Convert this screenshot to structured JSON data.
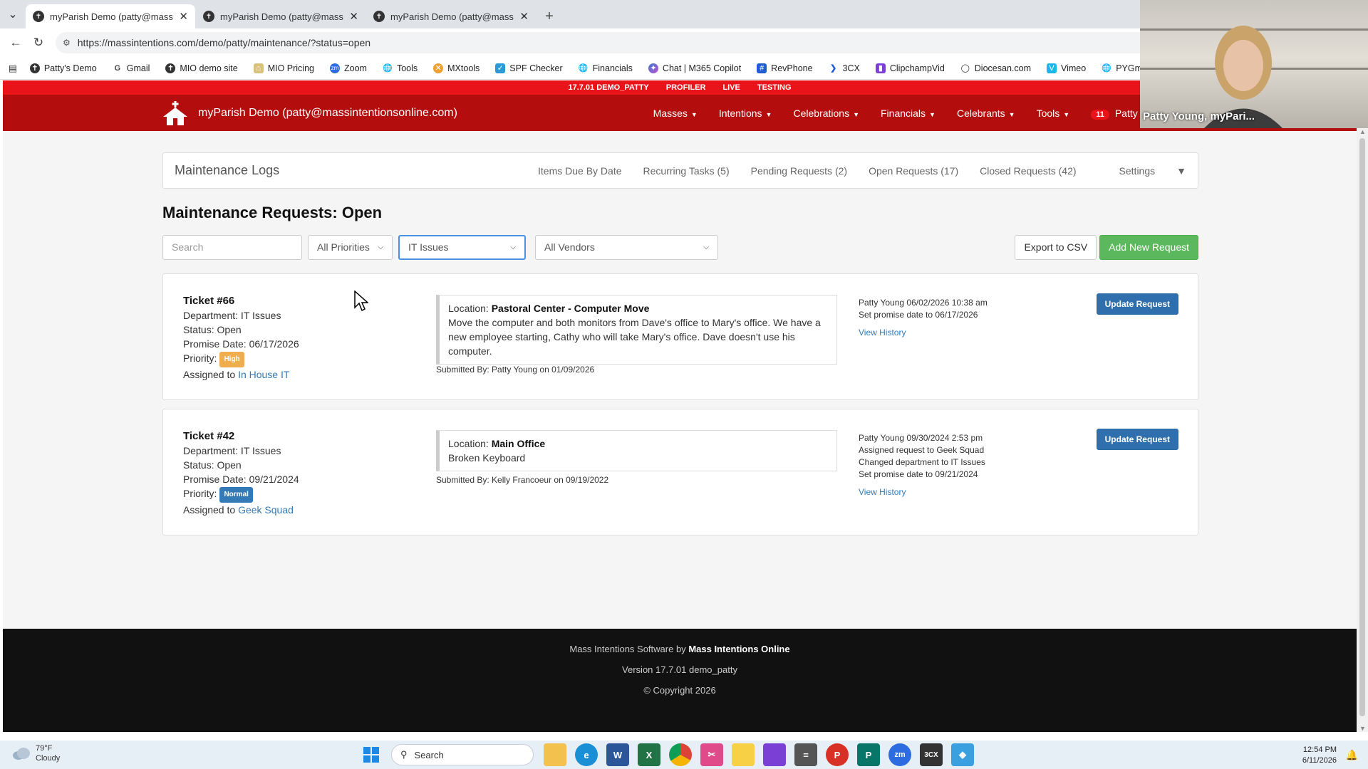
{
  "browser": {
    "tabs": [
      {
        "title": "myParish Demo (patty@massinten",
        "active": true
      },
      {
        "title": "myParish Demo (patty@massinten",
        "active": false
      },
      {
        "title": "myParish Demo (patty@massinten",
        "active": false
      }
    ],
    "url": "https://massintentions.com/demo/patty/maintenance/?status=open",
    "bookmarks": [
      {
        "label": "Patty's Demo",
        "icon": "church-icon"
      },
      {
        "label": "Gmail",
        "icon": "google-icon"
      },
      {
        "label": "MIO demo site",
        "icon": "church-icon"
      },
      {
        "label": "MIO Pricing",
        "icon": "pricing-icon"
      },
      {
        "label": "Zoom",
        "icon": "zoom-icon"
      },
      {
        "label": "Tools",
        "icon": "globe-icon"
      },
      {
        "label": "MXtools",
        "icon": "mxtools-icon"
      },
      {
        "label": "SPF Checker",
        "icon": "shield-icon"
      },
      {
        "label": "Financials",
        "icon": "globe-icon"
      },
      {
        "label": "Chat | M365 Copilot",
        "icon": "copilot-icon"
      },
      {
        "label": "RevPhone",
        "icon": "hash-icon"
      },
      {
        "label": "3CX",
        "icon": "3cx-icon"
      },
      {
        "label": "ClipchampVid",
        "icon": "clipchamp-icon"
      },
      {
        "label": "Diocesan.com",
        "icon": "circle-icon"
      },
      {
        "label": "Vimeo",
        "icon": "vimeo-icon"
      },
      {
        "label": "PYGmail",
        "icon": "globe-icon"
      }
    ]
  },
  "env": {
    "items": [
      "17.7.01 DEMO_PATTY",
      "PROFILER",
      "LIVE",
      "TESTING"
    ]
  },
  "nav": {
    "brand": "myParish Demo (patty@massintentionsonline.com)",
    "menu": [
      "Masses",
      "Intentions",
      "Celebrations",
      "Financials",
      "Celebrants",
      "Tools"
    ],
    "notif_count": "11",
    "user": "Patty You"
  },
  "subnav": {
    "title": "Maintenance Logs",
    "links": [
      "Items Due By Date",
      "Recurring Tasks (5)",
      "Pending Requests (2)",
      "Open Requests (17)",
      "Closed Requests (42)",
      "Settings"
    ]
  },
  "page": {
    "title": "Maintenance Requests: Open"
  },
  "filters": {
    "search_placeholder": "Search",
    "priority": "All Priorities",
    "department": "IT Issues",
    "vendor": "All Vendors",
    "export_label": "Export to CSV",
    "add_label": "Add New Request"
  },
  "tickets": [
    {
      "number": "Ticket #66",
      "department": "Department: IT Issues",
      "status": "Status: Open",
      "promise": "Promise Date: 06/17/2026",
      "priority_label": "Priority:",
      "priority": "High",
      "assigned_label": "Assigned to",
      "assigned": "In House IT",
      "location_label": "Location:",
      "location": "Pastoral Center - Computer Move",
      "description": "Move the computer and both monitors from Dave's office to Mary's office. We have a new employee starting, Cathy who will take Mary's office. Dave doesn't use his computer.",
      "submitted": "Submitted By: Patty Young on 01/09/2026",
      "history": [
        "Patty Young 06/02/2026 10:38 am",
        "Set promise date to 06/17/2026"
      ],
      "view_history": "View History",
      "update_label": "Update Request"
    },
    {
      "number": "Ticket #42",
      "department": "Department: IT Issues",
      "status": "Status: Open",
      "promise": "Promise Date: 09/21/2024",
      "priority_label": "Priority:",
      "priority": "Normal",
      "assigned_label": "Assigned to",
      "assigned": "Geek Squad",
      "location_label": "Location:",
      "location": "Main Office",
      "description": "Broken Keyboard",
      "submitted": "Submitted By: Kelly Francoeur on 09/19/2022",
      "history": [
        "Patty Young 09/30/2024 2:53 pm",
        "Assigned request to Geek Squad",
        "Changed department to IT Issues",
        "Set promise date to 09/21/2024"
      ],
      "view_history": "View History",
      "update_label": "Update Request"
    }
  ],
  "footer": {
    "line1_prefix": "Mass Intentions Software by",
    "line1_brand": "Mass Intentions Online",
    "version": "Version 17.7.01 demo_patty",
    "copyright": "© Copyright 2026"
  },
  "webcam": {
    "name": "Patty Young, myPari..."
  },
  "taskbar": {
    "temp": "79°F",
    "condition": "Cloudy",
    "search": "Search",
    "time": "12:54 PM",
    "date": "6/11/2026"
  },
  "colors": {
    "brand_red": "#b30d0d",
    "env_red": "#e8141a",
    "success": "#5cb85c",
    "primary": "#337ab7",
    "warning": "#f0ad4e"
  }
}
